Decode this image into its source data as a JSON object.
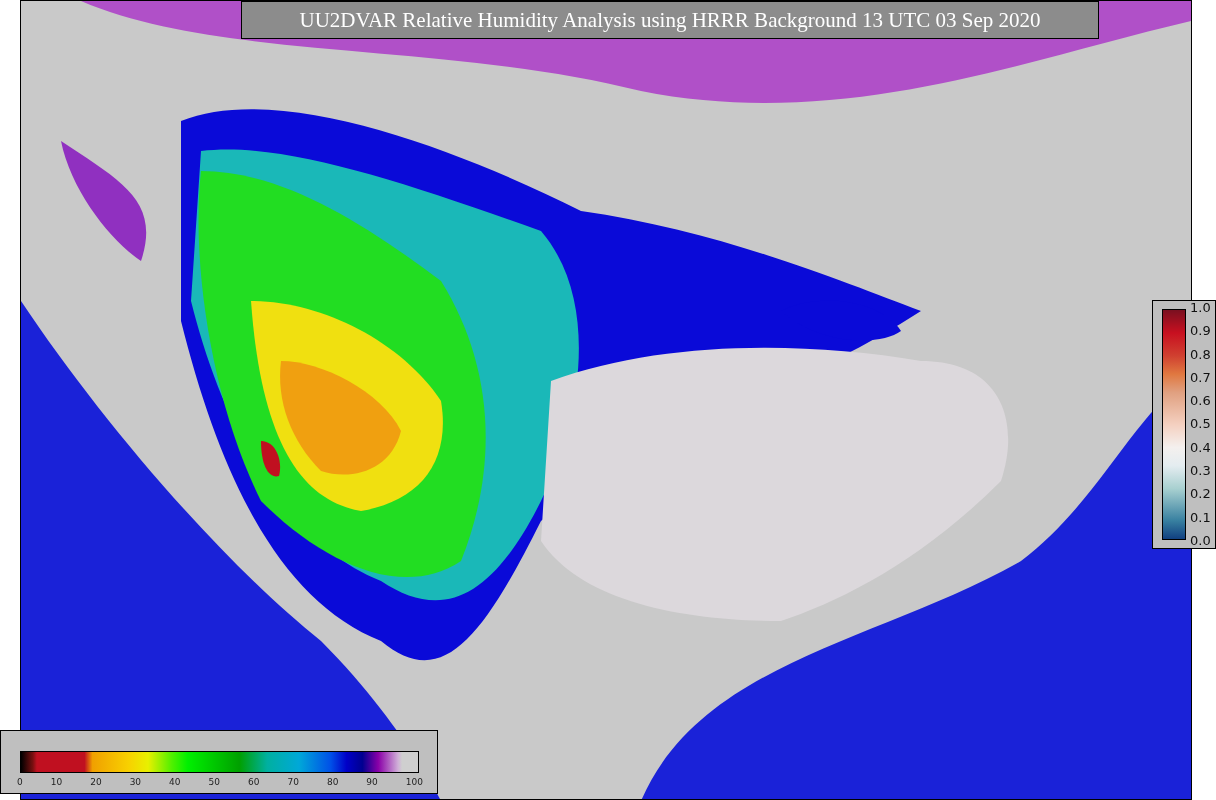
{
  "title": "UU2DVAR Relative Humidity Analysis using HRRR Background 13 UTC 03 Sep 2020",
  "humidity_legend": {
    "ticks": [
      "0",
      "10",
      "20",
      "30",
      "40",
      "50",
      "60",
      "70",
      "80",
      "90",
      "100"
    ]
  },
  "ratio_legend": {
    "ticks": [
      "1.0",
      "0.9",
      "0.8",
      "0.7",
      "0.6",
      "0.5",
      "0.4",
      "0.3",
      "0.2",
      "0.1",
      "0.0"
    ]
  }
}
